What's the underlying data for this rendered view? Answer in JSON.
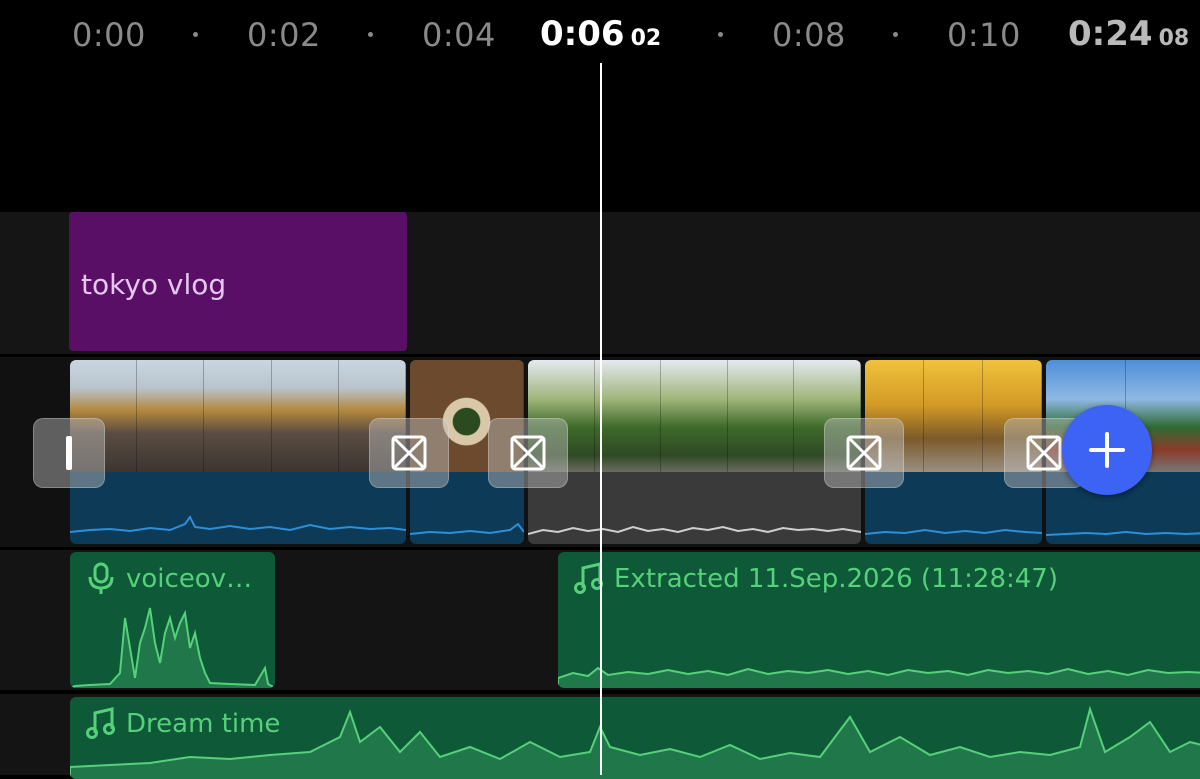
{
  "ruler": {
    "ticks": [
      "0:00",
      "0:02",
      "0:04",
      "0:08",
      "0:10"
    ],
    "current_time": "0:06",
    "current_frames": "02",
    "total_time": "0:24",
    "total_frames": "08"
  },
  "tracks": {
    "title_clip": "tokyo vlog",
    "audio_clips": {
      "voiceover": "voiceov…",
      "extracted": "Extracted 11.Sep.2026 (11:28:47)",
      "music": "Dream time"
    }
  },
  "icons": {
    "transition": "crossed-box-icon",
    "add": "plus-icon",
    "voiceover": "microphone-icon",
    "music": "music-note-icon"
  },
  "colors": {
    "accent": "#3d63f5",
    "title_clip": "#5a0f66",
    "audio_clip": "#0e5a38",
    "audio_wave": "#56d07a",
    "video_wave": "#2d8fd8"
  }
}
